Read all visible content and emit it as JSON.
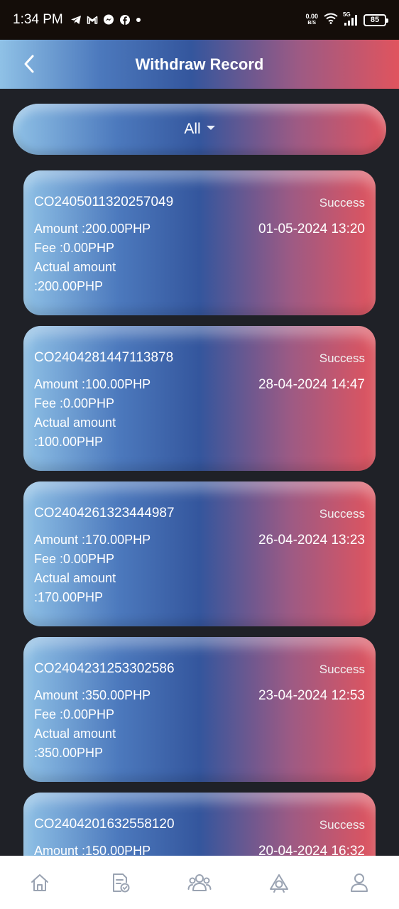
{
  "status_bar": {
    "time": "1:34 PM",
    "net_speed_value": "0.00",
    "net_speed_unit": "B/S",
    "network": "5G",
    "battery": "85",
    "icons": [
      "telegram-icon",
      "gmail-icon",
      "messenger-icon",
      "facebook-icon",
      "dot-icon",
      "wifi-icon",
      "signal-icon",
      "battery-icon"
    ]
  },
  "header": {
    "title": "Withdraw Record",
    "back_icon": "chevron-left-icon"
  },
  "filter": {
    "selected": "All"
  },
  "records": [
    {
      "id": "CO2405011320257049",
      "status": "Success",
      "amount": "Amount :200.00PHP",
      "fee": "Fee :0.00PHP",
      "actual_label": "Actual amount",
      "actual_value": ":200.00PHP",
      "date": "01-05-2024 13:20"
    },
    {
      "id": "CO2404281447113878",
      "status": "Success",
      "amount": "Amount :100.00PHP",
      "fee": "Fee :0.00PHP",
      "actual_label": "Actual amount",
      "actual_value": ":100.00PHP",
      "date": "28-04-2024 14:47"
    },
    {
      "id": "CO2404261323444987",
      "status": "Success",
      "amount": "Amount :170.00PHP",
      "fee": "Fee :0.00PHP",
      "actual_label": "Actual amount",
      "actual_value": ":170.00PHP",
      "date": "26-04-2024 13:23"
    },
    {
      "id": "CO2404231253302586",
      "status": "Success",
      "amount": "Amount :350.00PHP",
      "fee": "Fee :0.00PHP",
      "actual_label": "Actual amount",
      "actual_value": ":350.00PHP",
      "date": "23-04-2024 12:53"
    },
    {
      "id": "CO2404201632558120",
      "status": "Success",
      "amount": "Amount :150.00PHP",
      "fee": "",
      "actual_label": "",
      "actual_value": "",
      "date": "20-04-2024 16:32"
    }
  ],
  "bottom_nav": {
    "items": [
      "home-icon",
      "orders-icon",
      "team-icon",
      "promotion-icon",
      "profile-icon"
    ],
    "color": "#9aa3b2"
  }
}
